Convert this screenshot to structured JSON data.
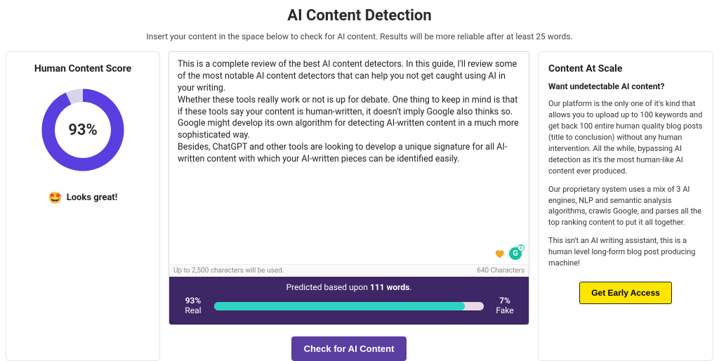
{
  "header": {
    "title": "AI Content Detection",
    "subtitle": "Insert your content in the space below to check for AI content. Results will be more reliable after at least 25 words."
  },
  "score_card": {
    "title": "Human Content Score",
    "percent_label": "93%",
    "percent_value": 93,
    "status_emoji": "🤩",
    "status_text": "Looks great!"
  },
  "editor": {
    "paragraphs": [
      "This is a complete review of the best AI content detectors. In this guide, I'll review some of the most notable AI content detectors that can help you not get caught using AI in your writing.",
      "Whether these tools really work or not is up for debate. One thing to keep in mind is that if these tools say your content is human-written, it doesn't imply Google also thinks so. Google might develop its own algorithm for detecting AI-written content in a much more sophisticated way.",
      "Besides, ChatGPT and other tools are looking to develop a unique signature for all AI-written content with which your AI-written pieces can be identified easily."
    ],
    "limit_note": "Up to 2,500 characters will be used.",
    "char_count": "640 Characters",
    "grammarly_badge": "2"
  },
  "result": {
    "predicted_prefix": "Predicted based upon ",
    "word_count": "111 words",
    "predicted_suffix": ".",
    "real_pct": "93%",
    "real_label": "Real",
    "fake_pct": "7%",
    "fake_label": "Fake",
    "fill_percent": 93
  },
  "check_button": "Check for AI Content",
  "promo": {
    "title": "Content At Scale",
    "subtitle": "Want undetectable AI content?",
    "p1": "Our platform is the only one of it's kind that allows you to upload up to 100 keywords and get back 100 entire human quality blog posts (title to conclusion) without any human intervention. All the while, bypassing AI detection as it's the most human-like AI content ever produced.",
    "p2": "Our proprietary system uses a mix of 3 AI engines, NLP and semantic analysis algorithms, crawls Google, and parses all the top ranking content to put it all together.",
    "p3": "This isn't an AI writing assistant, this is a human level long-form blog post producing machine!",
    "cta": "Get Early Access"
  },
  "chart_data": {
    "type": "bar",
    "title": "Human Content Score",
    "categories": [
      "Real",
      "Fake"
    ],
    "values": [
      93,
      7
    ],
    "ylim": [
      0,
      100
    ]
  }
}
